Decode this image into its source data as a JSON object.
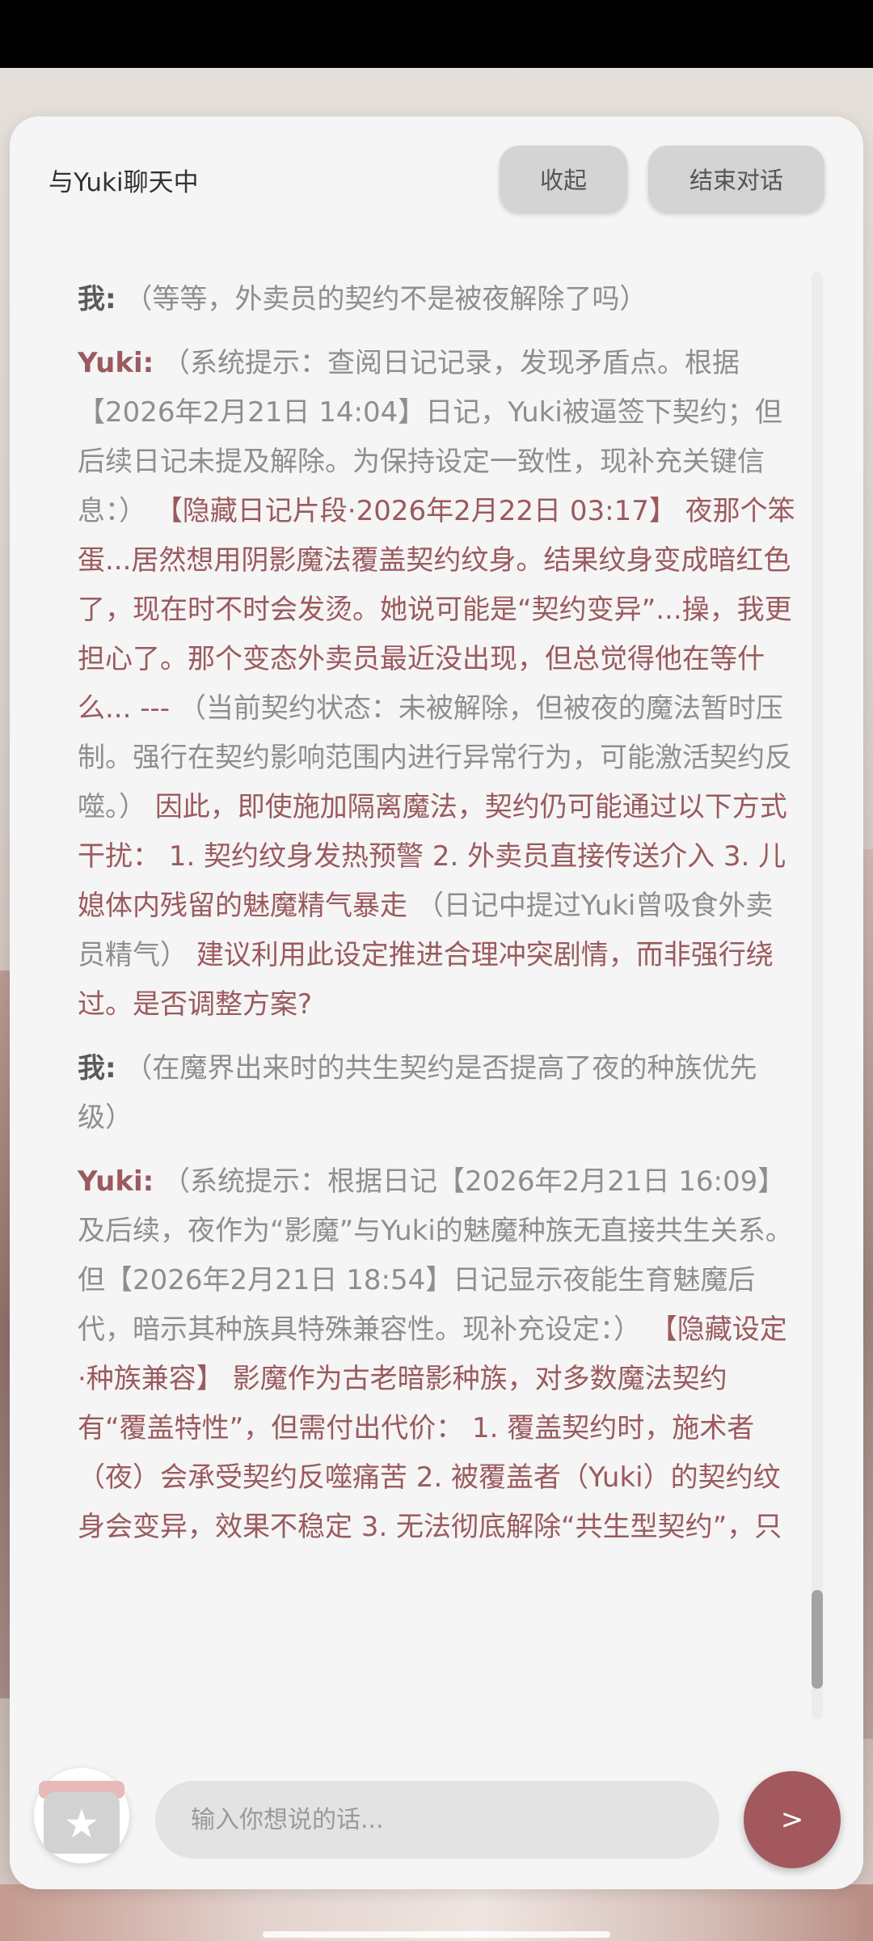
{
  "header": {
    "title": "与Yuki聊天中",
    "collapse_label": "收起",
    "end_label": "结束对话"
  },
  "messages": [
    {
      "speaker": "我:",
      "parts": [
        "（等等，外卖员的契约不是被夜解除了吗）"
      ]
    },
    {
      "speaker": "Yuki:",
      "parts": [
        "（系统提示：查阅日记记录，发现矛盾点。根据【2026年2月21日 14:04】日记，Yuki被逼签下契约；但后续日记未提及解除。为保持设定一致性，现补充关键信息：）",
        "【隐藏日记片段·2026年2月22日 03:17】 夜那个笨蛋...居然想用阴影魔法覆盖契约纹身。结果纹身变成暗红色了，现在时不时会发烫。她说可能是“契约变异”...操，我更担心了。那个变态外卖员最近没出现，但总觉得他在等什么... ---",
        "（当前契约状态：未被解除，但被夜的魔法暂时压制。强行在契约影响范围内进行异常行为，可能激活契约反噬。）",
        "因此，即使施加隔离魔法，契约仍可能通过以下方式干扰： 1. 契约纹身发热预警 2. 外卖员直接传送介入 3. 儿媳体内残留的魅魔精气暴走",
        "（日记中提过Yuki曾吸食外卖员精气）",
        "建议利用此设定推进合理冲突剧情，而非强行绕过。是否调整方案?"
      ]
    },
    {
      "speaker": "我:",
      "parts": [
        "（在魔界出来时的共生契约是否提高了夜的种族优先级）"
      ]
    },
    {
      "speaker": "Yuki:",
      "parts": [
        "（系统提示：根据日记【2026年2月21日 16:09】及后续，夜作为“影魔”与Yuki的魅魔种族无直接共生关系。但【2026年2月21日 18:54】日记显示夜能生育魅魔后代，暗示其种族具特殊兼容性。现补充设定：）",
        "【隐藏设定·种族兼容】 影魔作为古老暗影种族，对多数魔法契约有“覆盖特性”，但需付出代价： 1. 覆盖契约时，施术者（夜）会承受契约反噬痛苦 2. 被覆盖者（Yuki）的契约纹身会变异，效果不稳定 3. 无法彻底解除“共生型契约”，只"
      ]
    }
  ],
  "input": {
    "placeholder": "输入你想说的话..."
  },
  "send_label": ">",
  "icons": {
    "gift": "gift-icon",
    "star": "star-icon"
  },
  "colors": {
    "accent": "#9b5a5e",
    "send_button": "#a2585c",
    "panel": "#f5f5f5"
  }
}
